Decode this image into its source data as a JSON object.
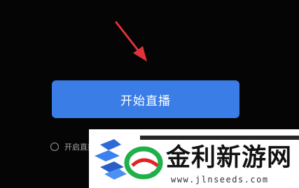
{
  "main": {
    "start_button_label": "开始直播",
    "option_label": "开启直播..."
  },
  "watermark": {
    "title": "金利新游网",
    "url": "www.jlnseeds.com"
  },
  "colors": {
    "background": "#050505",
    "button": "#3b7de6",
    "arrow": "#e0323a"
  },
  "icons": {
    "annotation": "arrow-pointer-icon",
    "logo": "jlnseeds-logo-icon"
  }
}
